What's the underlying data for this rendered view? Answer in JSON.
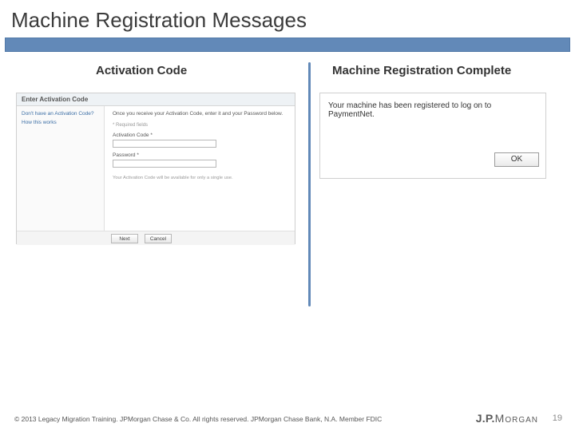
{
  "title": "Machine Registration Messages",
  "columns": {
    "left": "Activation Code",
    "right": "Machine Registration Complete"
  },
  "left_panel": {
    "header": "Enter Activation Code",
    "sidebar": {
      "link_have_code": "Don't have an Activation Code?",
      "link_how": "How this works"
    },
    "required_note": "* Required fields",
    "intro": "Once you receive your Activation Code, enter it and your Password below.",
    "label_code": "Activation Code *",
    "label_password": "Password *",
    "note": "Your Activation Code will be available for only a single use.",
    "btn_next": "Next",
    "btn_cancel": "Cancel"
  },
  "right_panel": {
    "message": "Your machine has been registered to log on to PaymentNet.",
    "btn_ok": "OK"
  },
  "footer": "© 2013 Legacy Migration Training. JPMorgan Chase & Co. All rights reserved. JPMorgan Chase Bank, N.A. Member FDIC",
  "logo": {
    "jp": "J.P.",
    "morgan": "Morgan"
  },
  "page_number": "19"
}
